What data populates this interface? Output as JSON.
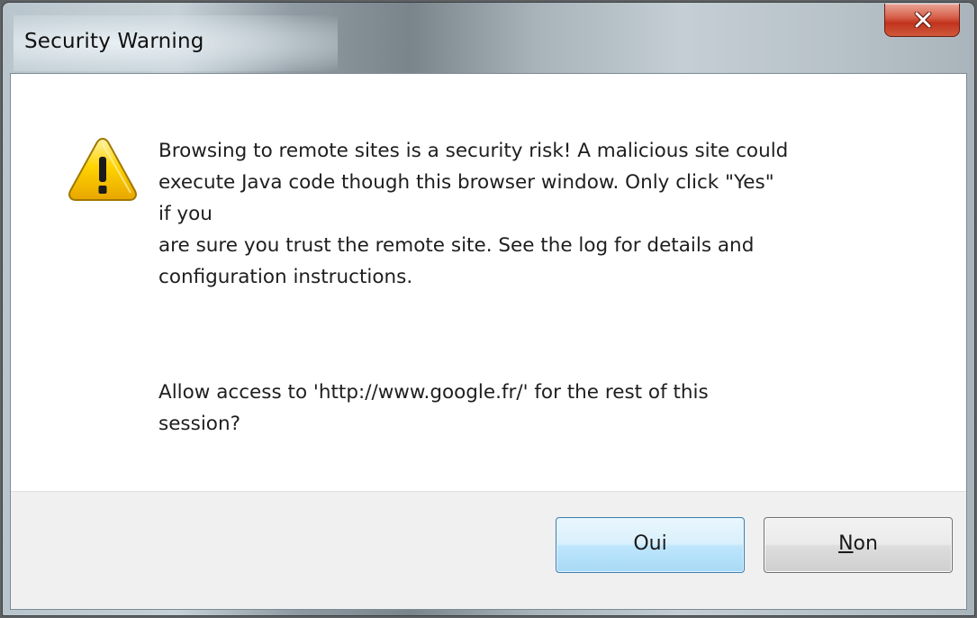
{
  "window": {
    "title": "Security Warning"
  },
  "message": {
    "lines": [
      "Browsing to remote sites is a security risk!  A malicious site could",
      "execute Java code though this browser window.  Only click \"Yes\"",
      "if you",
      "are sure you trust the remote site.  See the log for details and",
      "configuration instructions."
    ],
    "question_lines": [
      "Allow access to 'http://www.google.fr/' for the rest of this",
      "session?"
    ]
  },
  "buttons": {
    "yes_label": "Oui",
    "no_mnemonic": "N",
    "no_rest": "on"
  },
  "icons": {
    "warning": "warning-triangle-icon",
    "close": "close-icon"
  },
  "colors": {
    "close_button": "#c2331d",
    "default_button_border": "#3c7fb1",
    "warning_yellow": "#f5c400"
  }
}
